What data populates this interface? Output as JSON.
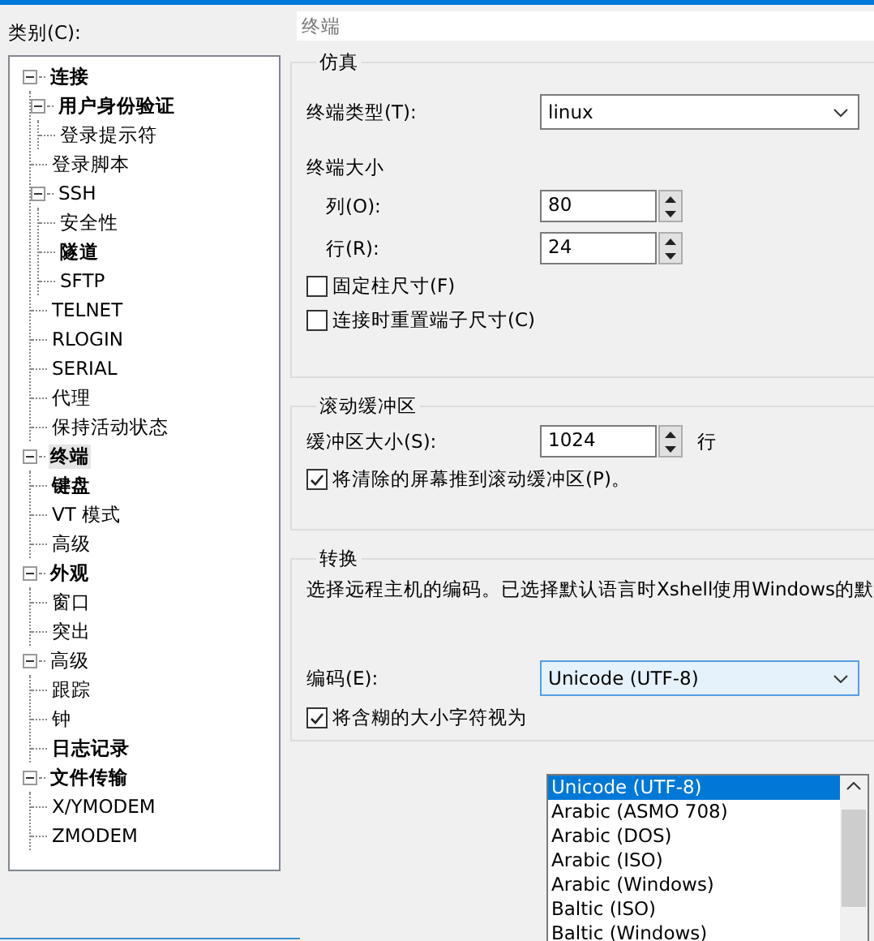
{
  "category_label": "类别(C):",
  "tree": [
    {
      "label": "连接",
      "bold": true,
      "expanded": true,
      "children": [
        {
          "label": "用户身份验证",
          "bold": true,
          "expanded": true,
          "children": [
            {
              "label": "登录提示符",
              "bold": false
            }
          ]
        },
        {
          "label": "登录脚本",
          "bold": false
        },
        {
          "label": "SSH",
          "bold": false,
          "expanded": true,
          "children": [
            {
              "label": "安全性",
              "bold": false
            },
            {
              "label": "隧道",
              "bold": true
            },
            {
              "label": "SFTP",
              "bold": false
            }
          ]
        },
        {
          "label": "TELNET",
          "bold": false
        },
        {
          "label": "RLOGIN",
          "bold": false
        },
        {
          "label": "SERIAL",
          "bold": false
        },
        {
          "label": "代理",
          "bold": false
        },
        {
          "label": "保持活动状态",
          "bold": false
        }
      ]
    },
    {
      "label": "终端",
      "bold": true,
      "expanded": true,
      "selected": true,
      "children": [
        {
          "label": "键盘",
          "bold": true
        },
        {
          "label": "VT 模式",
          "bold": false
        },
        {
          "label": "高级",
          "bold": false
        }
      ]
    },
    {
      "label": "外观",
      "bold": true,
      "expanded": true,
      "children": [
        {
          "label": "窗口",
          "bold": false
        },
        {
          "label": "突出",
          "bold": false
        }
      ]
    },
    {
      "label": "高级",
      "bold": false,
      "expanded": true,
      "children": [
        {
          "label": "跟踪",
          "bold": false
        },
        {
          "label": "钟",
          "bold": false
        },
        {
          "label": "日志记录",
          "bold": true
        }
      ]
    },
    {
      "label": "文件传输",
      "bold": true,
      "expanded": true,
      "children": [
        {
          "label": "X/YMODEM",
          "bold": false
        },
        {
          "label": "ZMODEM",
          "bold": false
        }
      ]
    }
  ],
  "page_title": "终端",
  "emulation": {
    "title": "仿真",
    "terminal_type_label": "终端类型(T):",
    "terminal_type": "linux",
    "size_title": "终端大小",
    "columns_label": "列(O):",
    "columns": "80",
    "rows_label": "行(R):",
    "rows": "24",
    "options": [
      {
        "label": "固定柱尺寸(F)",
        "checked": false
      },
      {
        "label": "连接时重置端子尺寸(C)",
        "checked": false
      }
    ]
  },
  "scrollback": {
    "title": "滚动缓冲区",
    "size_label": "缓冲区大小(S):",
    "size": "1024",
    "unit": "行",
    "options": [
      {
        "label": "将清除的屏幕推到滚动缓冲区(P)。",
        "checked": true
      }
    ]
  },
  "translation": {
    "title": "转换",
    "description": "选择远程主机的编码。已选择默认语言时Xshell使用Windows的默",
    "encoding_label": "编码(E):",
    "encoding": "Unicode (UTF-8)",
    "options": [
      {
        "label": "将含糊的大小字符视为",
        "checked": true
      }
    ],
    "encoding_list": [
      {
        "label": "Unicode (UTF-8)",
        "selected": true
      },
      {
        "label": "Arabic (ASMO 708)",
        "selected": false
      },
      {
        "label": "Arabic (DOS)",
        "selected": false
      },
      {
        "label": "Arabic (ISO)",
        "selected": false
      },
      {
        "label": "Arabic (Windows)",
        "selected": false
      },
      {
        "label": "Baltic (ISO)",
        "selected": false
      },
      {
        "label": "Baltic (Windows)",
        "selected": false
      }
    ]
  }
}
